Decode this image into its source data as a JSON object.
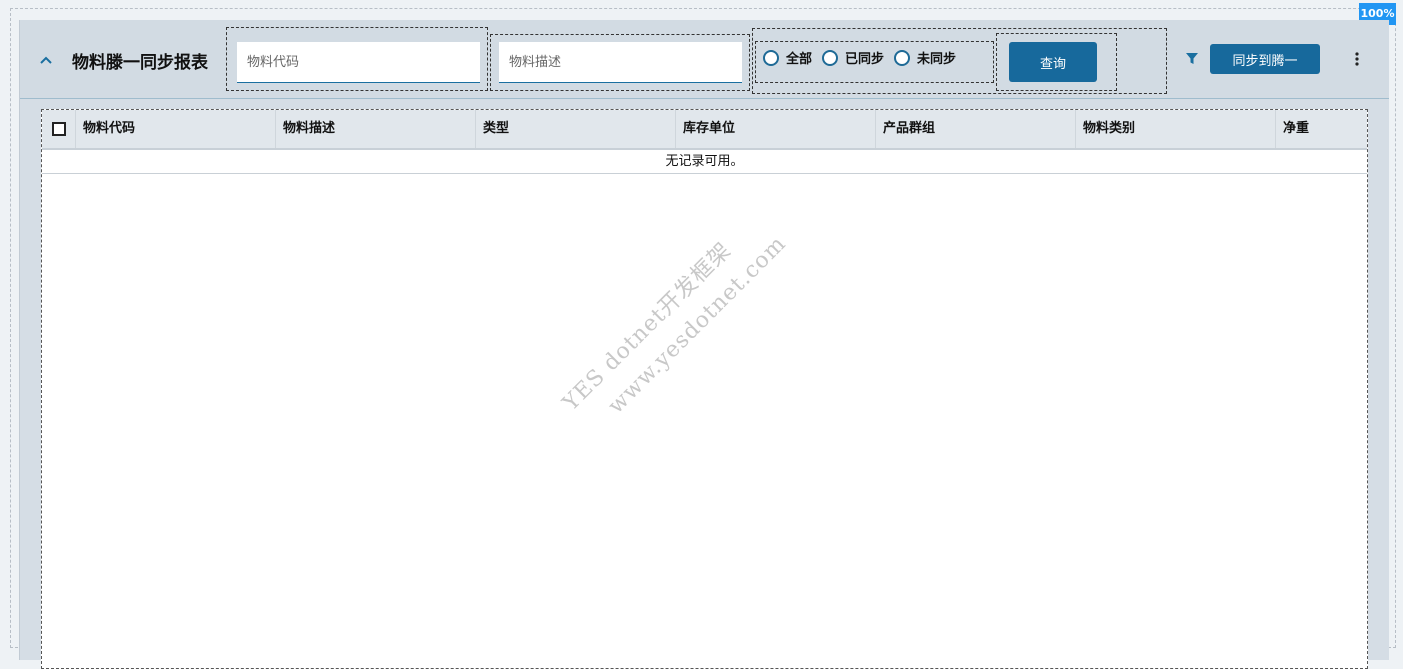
{
  "zoom": "100%",
  "header": {
    "title": "物料滕一同步报表",
    "material_code_placeholder": "物料代码",
    "material_desc_placeholder": "物料描述",
    "radios": [
      {
        "label": "全部",
        "selected": false
      },
      {
        "label": "已同步",
        "selected": false
      },
      {
        "label": "未同步",
        "selected": false
      }
    ],
    "query_label": "查询",
    "sync_label": "同步到腾一",
    "filter_icon": "filter-icon",
    "more_icon": "more-vertical-icon",
    "collapse_icon": "chevron-up-icon"
  },
  "grid": {
    "columns": [
      "物料代码",
      "物料描述",
      "类型",
      "库存单位",
      "产品群组",
      "物料类别",
      "净重"
    ],
    "empty_text": "无记录可用。"
  },
  "watermark": {
    "line1": "YES dotnet开发框架",
    "line2": "www.yesdotnet.com"
  },
  "colors": {
    "accent": "#17699c",
    "badge": "#2196f3",
    "header_bg": "#d2dbe3"
  }
}
